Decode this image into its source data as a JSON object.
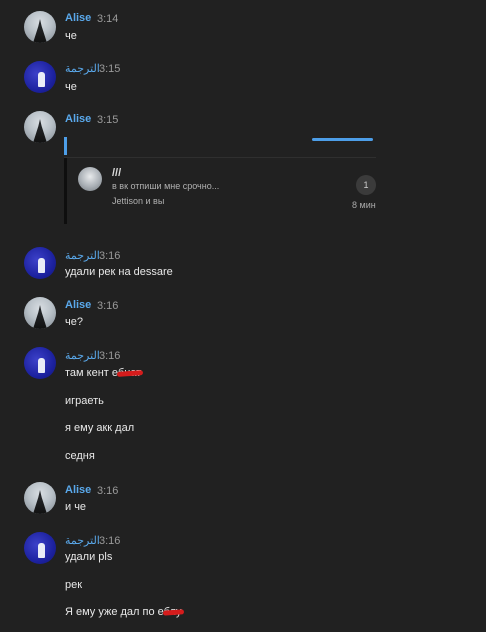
{
  "messages": [
    {
      "author": "Alise",
      "time": "3:14",
      "lines": [
        "че"
      ]
    },
    {
      "author": "الترجمة",
      "time": "3:15",
      "lines": [
        "че"
      ]
    },
    {
      "author": "Alise",
      "time": "3:15"
    },
    {
      "author": "الترجمة",
      "time": "3:16",
      "lines": [
        "удали рек на dessare"
      ]
    },
    {
      "author": "Alise",
      "time": "3:16",
      "lines": [
        "че?"
      ]
    },
    {
      "author": "الترجمة",
      "time": "3:16",
      "lines": [
        "там кент е",
        "бнат",
        "играеть",
        "я ему акк дал",
        "седня"
      ]
    },
    {
      "author": "Alise",
      "time": "3:16",
      "lines": [
        "и че"
      ]
    },
    {
      "author": "الترجمة",
      "time": "3:16",
      "lines": [
        "удали pls",
        "рек",
        "Я ему уже дал по е",
        "блу"
      ]
    }
  ],
  "forwarded": {
    "title": "///",
    "preview": "в вк отпиши мне срочно...",
    "members": "Jettison и вы",
    "badge": "1",
    "time": "8 мин"
  },
  "colors": {
    "background": "#212121",
    "name": "#5aa9ec",
    "accent": "#4d9ee8",
    "redact": "#d51c1c"
  }
}
